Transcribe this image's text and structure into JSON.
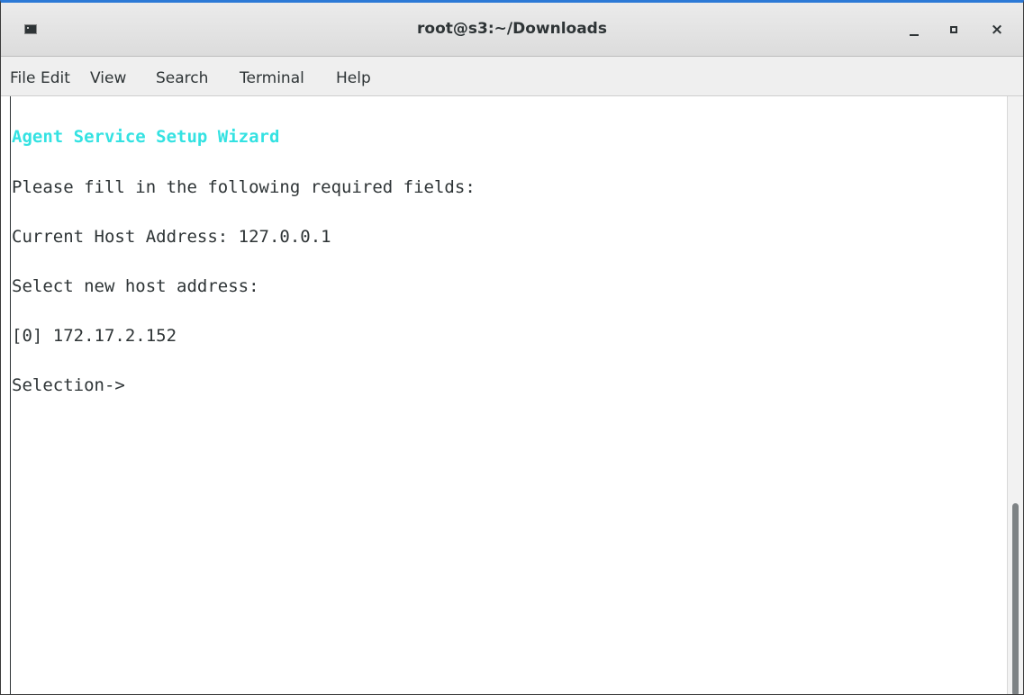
{
  "window": {
    "title": "root@s3:~/Downloads",
    "icon": "terminal-icon",
    "accent_color": "#2c79d6"
  },
  "controls": {
    "minimize": "_",
    "maximize": "□",
    "close": "×"
  },
  "menu": [
    "File",
    "Edit",
    "View",
    "Search",
    "Terminal",
    "Help"
  ],
  "terminal": {
    "header_color": "#34e2e2",
    "lines": [
      "Agent Service Setup Wizard",
      "Please fill in the following required fields:",
      "Current Host Address: 127.0.0.1",
      "Select new host address:",
      "[0] 172.17.2.152",
      "Selection->"
    ]
  }
}
